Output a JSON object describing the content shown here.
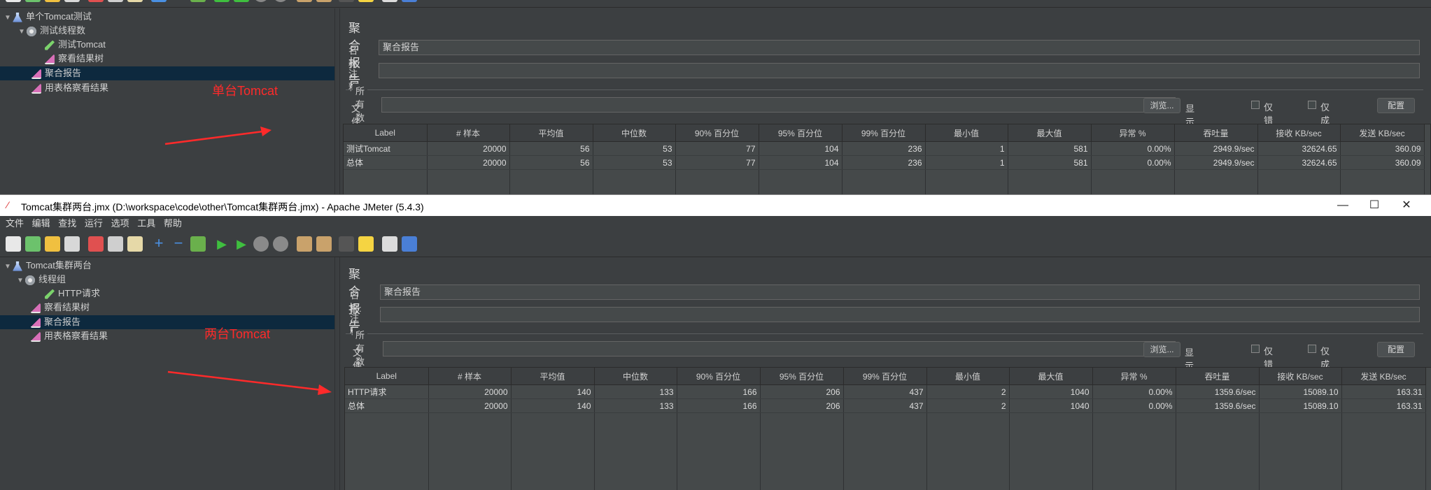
{
  "top": {
    "tree": {
      "root": "单个Tomcat测试",
      "thread_group": "测试线程数",
      "sampler": "测试Tomcat",
      "items": [
        "察看结果树",
        "聚合报告",
        "用表格察看结果"
      ]
    },
    "panel": {
      "title": "聚合报告",
      "name_label": "名称:",
      "name_value": "聚合报告",
      "comment_label": "注释:",
      "comment_value": "",
      "file_section": "所有数据写入一个文件",
      "filename_label": "文件名",
      "filename_value": "",
      "browse": "浏览...",
      "log_content_label": "显示日志内容:",
      "only_errors": "仅错误日志",
      "only_success": "仅成功日志",
      "configure": "配置"
    },
    "table": {
      "headers": [
        "Label",
        "# 样本",
        "平均值",
        "中位数",
        "90% 百分位",
        "95% 百分位",
        "99% 百分位",
        "最小值",
        "最大值",
        "异常 %",
        "吞吐量",
        "接收 KB/sec",
        "发送 KB/sec"
      ],
      "rows": [
        [
          "测试Tomcat",
          "20000",
          "56",
          "53",
          "77",
          "104",
          "236",
          "1",
          "581",
          "0.00%",
          "2949.9/sec",
          "32624.65",
          "360.09"
        ],
        [
          "总体",
          "20000",
          "56",
          "53",
          "77",
          "104",
          "236",
          "1",
          "581",
          "0.00%",
          "2949.9/sec",
          "32624.65",
          "360.09"
        ]
      ]
    },
    "annotation": "单台Tomcat"
  },
  "bottom": {
    "window_title": "Tomcat集群两台.jmx (D:\\workspace\\code\\other\\Tomcat集群两台.jmx) - Apache JMeter (5.4.3)",
    "menu": [
      "文件",
      "编辑",
      "查找",
      "运行",
      "选项",
      "工具",
      "帮助"
    ],
    "tree": {
      "root": "Tomcat集群两台",
      "thread_group": "线程组",
      "sampler": "HTTP请求",
      "items": [
        "察看结果树",
        "聚合报告",
        "用表格察看结果"
      ]
    },
    "panel": {
      "title": "聚合报告",
      "name_label": "名称:",
      "name_value": "聚合报告",
      "comment_label": "注释:",
      "comment_value": "",
      "file_section": "所有数据写入一个文件",
      "filename_label": "文件名",
      "filename_value": "",
      "browse": "浏览...",
      "log_content_label": "显示日志内容:",
      "only_errors": "仅错误日志",
      "only_success": "仅成功日志",
      "configure": "配置"
    },
    "table": {
      "headers": [
        "Label",
        "# 样本",
        "平均值",
        "中位数",
        "90% 百分位",
        "95% 百分位",
        "99% 百分位",
        "最小值",
        "最大值",
        "异常 %",
        "吞吐量",
        "接收 KB/sec",
        "发送 KB/sec"
      ],
      "rows": [
        [
          "HTTP请求",
          "20000",
          "140",
          "133",
          "166",
          "206",
          "437",
          "2",
          "1040",
          "0.00%",
          "1359.6/sec",
          "15089.10",
          "163.31"
        ],
        [
          "总体",
          "20000",
          "140",
          "133",
          "166",
          "206",
          "437",
          "2",
          "1040",
          "0.00%",
          "1359.6/sec",
          "15089.10",
          "163.31"
        ]
      ]
    },
    "annotation": "两台Tomcat"
  },
  "colors": {
    "background": "#3c3f41",
    "selection": "#0d293e",
    "annotation": "#ff2a2a"
  }
}
